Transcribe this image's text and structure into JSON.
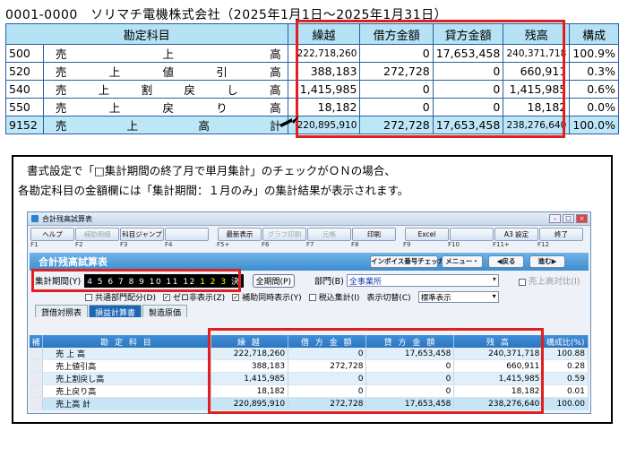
{
  "header": {
    "company_line": "0001-0000　ソリマチ電機株式会社（2025年1月1日～2025年1月31日）"
  },
  "top_table": {
    "headers": {
      "account": "勘定科目",
      "kurikoshi": "繰越",
      "kari": "借方金額",
      "kashi": "貸方金額",
      "zandaka": "残高",
      "kosei": "構成"
    },
    "rows": [
      {
        "code": "500",
        "chars": [
          "売",
          "上",
          "高"
        ],
        "kurikoshi": "222,718,260",
        "kari": "0",
        "kashi": "17,653,458",
        "zandaka": "240,371,718",
        "kosei": "100.9%"
      },
      {
        "code": "520",
        "chars": [
          "売",
          "上",
          "値",
          "引",
          "高"
        ],
        "kurikoshi": "388,183",
        "kari": "272,728",
        "kashi": "0",
        "zandaka": "660,911",
        "kosei": "0.3%"
      },
      {
        "code": "540",
        "chars": [
          "売",
          "上",
          "割",
          "戻",
          "し",
          "高"
        ],
        "kurikoshi": "1,415,985",
        "kari": "0",
        "kashi": "0",
        "zandaka": "1,415,985",
        "kosei": "0.6%"
      },
      {
        "code": "550",
        "chars": [
          "売",
          "上",
          "戻",
          "り",
          "高"
        ],
        "kurikoshi": "18,182",
        "kari": "0",
        "kashi": "0",
        "zandaka": "18,182",
        "kosei": "0.0%"
      },
      {
        "code": "9152",
        "chars": [
          "売",
          "上",
          "高",
          "計"
        ],
        "kurikoshi": "220,895,910",
        "kari": "272,728",
        "kashi": "17,653,458",
        "zandaka": "238,276,640",
        "kosei": "100.0%"
      }
    ]
  },
  "callout": {
    "line1": "書式設定で「□集計期間の終了月で単月集計」のチェックがＯＮの場合、",
    "line2": "各勘定科目の金額欄には「集計期間：１月のみ」の集計結果が表示されます。"
  },
  "app": {
    "title": "合計残高試算表",
    "fkeys": [
      "ヘルプ",
      "補助明細",
      "科目ジャンプ",
      "",
      "最新表示",
      "グラフ印刷",
      "元帳",
      "印刷",
      "Excel",
      "",
      "A3 設定",
      "終了"
    ],
    "fnums": [
      "F1",
      "F2",
      "F3",
      "F4",
      "F5+",
      "F6",
      "F7",
      "F8",
      "F9",
      "F10",
      "F11+",
      "F12"
    ],
    "banner_title": "合計残高試算表",
    "invoice_btn": "インボイス番号チェッカー",
    "menu_btn": "メニュー・",
    "back_btn": "◀戻る",
    "next_btn": "進む▶",
    "period_label": "集計期間(Y)",
    "period_months": "4 5 6 7 8 9 10 11 12",
    "period_months_hl": "1 2 3",
    "period_end": "決",
    "full_period_btn": "全期間(P)",
    "dept_label": "部門(B)",
    "dept_value": "全事業所",
    "sales_compare": "売上高対比(I)",
    "opt_common": "共通部門配分(D)",
    "opt_zero": "ゼロ非表示(Z)",
    "opt_aux": "補助同時表示(Y)",
    "opt_tax": "税込集計(I)",
    "view_label": "表示切替(C)",
    "view_value": "標準表示",
    "tabs": [
      "貸借対照表",
      "損益計算書",
      "製造原価"
    ],
    "grid_headers": {
      "idx": "補",
      "account": "勘 定 科 目",
      "kurikoshi": "繰 越",
      "kari": "借 方 金 額",
      "kashi": "貸 方 金 額",
      "zandaka": "残 高",
      "kosei": "構成比(%)"
    },
    "grid_rows": [
      {
        "account": "売 上 高",
        "kurikoshi": "222,718,260",
        "kari": "0",
        "kashi": "17,653,458",
        "zandaka": "240,371,718",
        "kosei": "100.88"
      },
      {
        "account": "売上値引高",
        "kurikoshi": "388,183",
        "kari": "272,728",
        "kashi": "0",
        "zandaka": "660,911",
        "kosei": "0.28"
      },
      {
        "account": "売上割戻し高",
        "kurikoshi": "1,415,985",
        "kari": "0",
        "kashi": "0",
        "zandaka": "1,415,985",
        "kosei": "0.59"
      },
      {
        "account": "売上戻り高",
        "kurikoshi": "18,182",
        "kari": "0",
        "kashi": "0",
        "zandaka": "18,182",
        "kosei": "0.01"
      },
      {
        "account": "売上高 計",
        "kurikoshi": "220,895,910",
        "kari": "272,728",
        "kashi": "17,653,458",
        "zandaka": "238,276,640",
        "kosei": "100.00"
      }
    ]
  },
  "colors": {
    "highlight_box": "#e02020",
    "header_bg": "#b5e2f5",
    "app_blue": "#3d8dd0"
  }
}
